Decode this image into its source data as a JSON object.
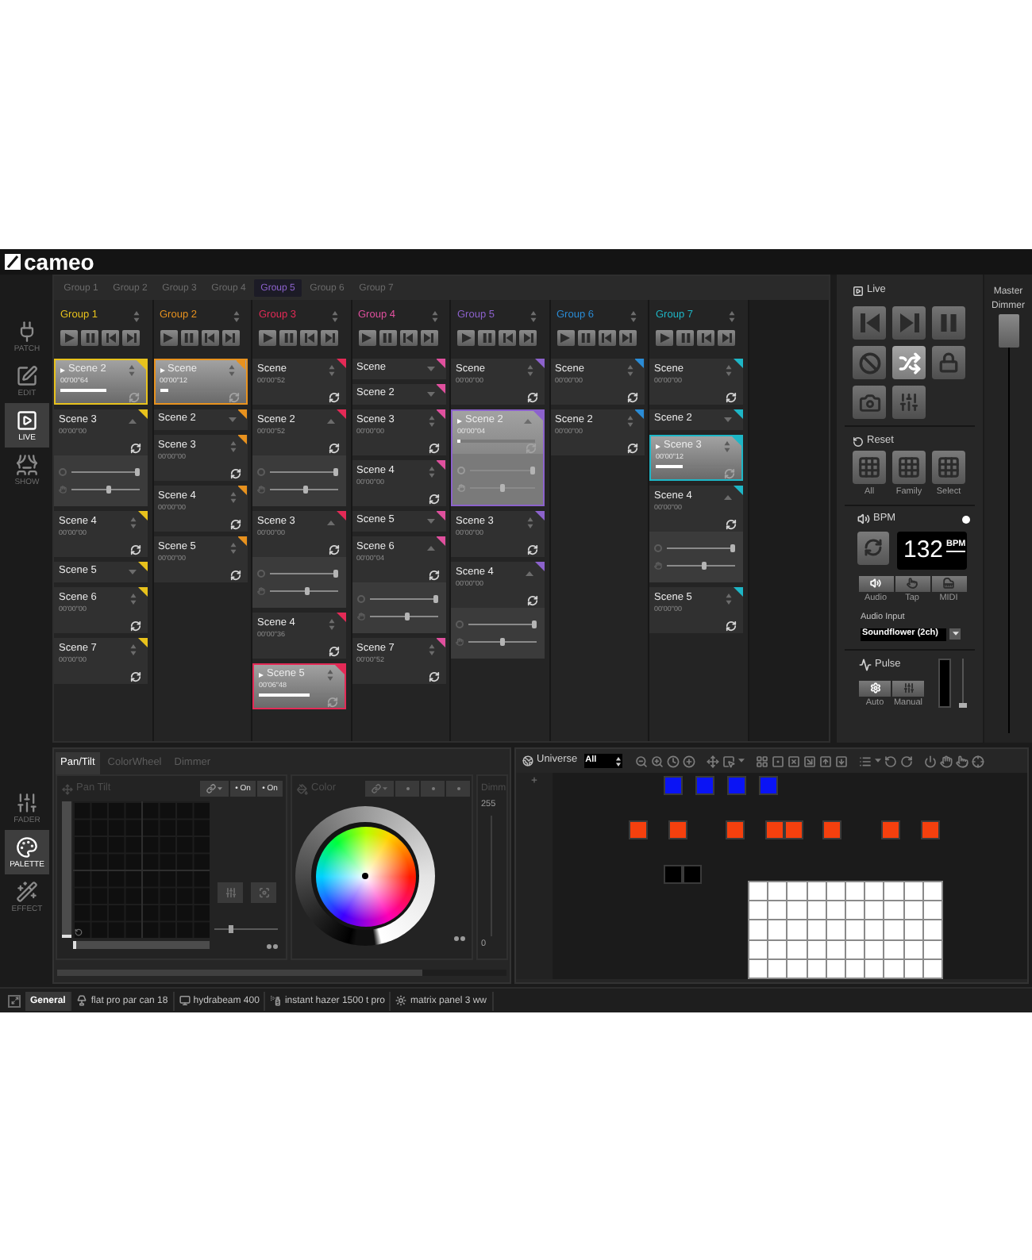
{
  "brand": "cameo",
  "side_nav": [
    {
      "label": "PATCH",
      "kind": "patch",
      "selected": false
    },
    {
      "label": "EDIT",
      "kind": "edit",
      "selected": false
    },
    {
      "label": "LIVE",
      "kind": "live",
      "selected": true
    },
    {
      "label": "SHOW",
      "kind": "show",
      "selected": false
    }
  ],
  "group_tabs": [
    {
      "label": "Group 1",
      "selected": false
    },
    {
      "label": "Group 2",
      "selected": false
    },
    {
      "label": "Group 3",
      "selected": false
    },
    {
      "label": "Group 4",
      "selected": false
    },
    {
      "label": "Group 5",
      "selected": true
    },
    {
      "label": "Group 6",
      "selected": false
    },
    {
      "label": "Group 7",
      "selected": false
    }
  ],
  "groups": [
    {
      "name": "Group 1",
      "color": "#e8c21c",
      "scenes": [
        {
          "name": "Scene 2",
          "time": "00'00\"64",
          "kind": "card",
          "playing": true,
          "level": 0.6
        },
        {
          "name": "Scene 3",
          "time": "00'00\"00",
          "kind": "expanded",
          "playing": false,
          "sliders": [
            {
              "level": 1
            },
            {
              "level": 0.55
            }
          ]
        },
        {
          "name": "Scene 4",
          "time": "00'00\"00",
          "kind": "card",
          "playing": false
        },
        {
          "name": "Scene 5",
          "kind": "collapsed",
          "playing": false
        },
        {
          "name": "Scene 6",
          "time": "00'00\"00",
          "kind": "card",
          "playing": false
        },
        {
          "name": "Scene 7",
          "time": "00'00\"00",
          "kind": "card",
          "playing": false
        }
      ]
    },
    {
      "name": "Group 2",
      "color": "#e8921e",
      "scenes": [
        {
          "name": "Scene",
          "time": "00'00\"12",
          "kind": "card",
          "playing": true,
          "level": 0.12
        },
        {
          "name": "Scene 2",
          "kind": "collapsed",
          "playing": false
        },
        {
          "name": "Scene 3",
          "time": "00'00\"00",
          "kind": "card",
          "playing": false
        },
        {
          "name": "Scene 4",
          "time": "00'00\"00",
          "kind": "card",
          "playing": false
        },
        {
          "name": "Scene 5",
          "time": "00'00\"00",
          "kind": "card",
          "playing": false
        }
      ]
    },
    {
      "name": "Group 3",
      "color": "#e42a56",
      "scenes": [
        {
          "name": "Scene",
          "time": "00'00\"52",
          "kind": "card",
          "playing": false
        },
        {
          "name": "Scene 2",
          "time": "00'00\"52",
          "kind": "expanded",
          "playing": false,
          "sliders": [
            {
              "level": 1
            },
            {
              "level": 0.52
            }
          ]
        },
        {
          "name": "Scene 3",
          "time": "00'00\"00",
          "kind": "expanded",
          "playing": false,
          "sliders": [
            {
              "level": 1
            },
            {
              "level": 0.55
            }
          ]
        },
        {
          "name": "Scene 4",
          "time": "00'00\"36",
          "kind": "card",
          "playing": false
        },
        {
          "name": "Scene 5",
          "time": "00'06\"48",
          "kind": "card",
          "playing": true,
          "level": 0.65
        }
      ]
    },
    {
      "name": "Group 4",
      "color": "#e0509e",
      "scenes": [
        {
          "name": "Scene",
          "kind": "collapsed",
          "playing": false
        },
        {
          "name": "Scene 2",
          "kind": "collapsed",
          "playing": false
        },
        {
          "name": "Scene 3",
          "time": "00'00\"00",
          "kind": "card",
          "playing": false
        },
        {
          "name": "Scene 4",
          "time": "00'00\"00",
          "kind": "card",
          "playing": false
        },
        {
          "name": "Scene 5",
          "kind": "collapsed",
          "playing": false
        },
        {
          "name": "Scene 6",
          "time": "00'00\"04",
          "kind": "expanded",
          "playing": false,
          "sliders": [
            {
              "level": 1
            },
            {
              "level": 0.55
            }
          ]
        },
        {
          "name": "Scene 7",
          "time": "00'00\"52",
          "kind": "card",
          "playing": false
        }
      ]
    },
    {
      "name": "Group 5",
      "color": "#8c62cc",
      "scenes": [
        {
          "name": "Scene",
          "time": "00'00\"00",
          "kind": "card",
          "playing": false
        },
        {
          "name": "Scene 2",
          "time": "00'00\"04",
          "kind": "expanded",
          "playing": true,
          "level": 0.04,
          "sliders": [
            {
              "level": 1
            },
            {
              "level": 0.5
            }
          ]
        },
        {
          "name": "Scene 3",
          "time": "00'00\"00",
          "kind": "card",
          "playing": false
        },
        {
          "name": "Scene 4",
          "time": "00'00\"00",
          "kind": "expanded",
          "playing": false,
          "sliders": [
            {
              "level": 1
            },
            {
              "level": 0.5
            }
          ]
        }
      ]
    },
    {
      "name": "Group 6",
      "color": "#2a8cd6",
      "scenes": [
        {
          "name": "Scene",
          "time": "00'00\"00",
          "kind": "card",
          "playing": false
        },
        {
          "name": "Scene 2",
          "time": "00'00\"00",
          "kind": "card",
          "playing": false
        }
      ]
    },
    {
      "name": "Group 7",
      "color": "#1eb6c6",
      "scenes": [
        {
          "name": "Scene",
          "time": "00'00\"00",
          "kind": "card",
          "playing": false
        },
        {
          "name": "Scene 2",
          "kind": "collapsed",
          "playing": false
        },
        {
          "name": "Scene 3",
          "time": "00'00\"12",
          "kind": "card",
          "playing": true,
          "level": 0.35
        },
        {
          "name": "Scene 4",
          "time": "00'00\"00",
          "kind": "expanded",
          "playing": false,
          "sliders": [
            {
              "level": 1
            },
            {
              "level": 0.55
            }
          ]
        },
        {
          "name": "Scene 5",
          "time": "00'00\"00",
          "kind": "card",
          "playing": false
        }
      ]
    }
  ],
  "live": {
    "title": "Live",
    "buttons": [
      {
        "kind": "previous",
        "on": false
      },
      {
        "kind": "next",
        "on": false
      },
      {
        "kind": "pause",
        "on": false
      },
      {
        "kind": "blackout",
        "on": false
      },
      {
        "kind": "shuffle",
        "on": true
      },
      {
        "kind": "lock",
        "on": false
      },
      {
        "kind": "snapshot",
        "on": false
      },
      {
        "kind": "mixer",
        "on": false
      }
    ]
  },
  "reset": {
    "title": "Reset",
    "buttons": [
      {
        "label": "All"
      },
      {
        "label": "Family"
      },
      {
        "label": "Select"
      }
    ]
  },
  "bpm": {
    "title": "BPM",
    "on": true,
    "value": "132",
    "unit": "BPM",
    "sources": [
      {
        "label": "Audio",
        "kind": "audio",
        "selected": true
      },
      {
        "label": "Tap",
        "kind": "tap",
        "selected": false
      },
      {
        "label": "MIDI",
        "kind": "midi",
        "selected": false
      }
    ],
    "audio_input": {
      "label": "Audio Input",
      "value": "Soundflower (2ch)"
    }
  },
  "pulse": {
    "title": "Pulse",
    "modes": [
      {
        "label": "Auto",
        "kind": "auto",
        "selected": true
      },
      {
        "label": "Manual",
        "kind": "manual",
        "selected": false
      }
    ],
    "slider": {
      "level": 0
    }
  },
  "master": {
    "label": "Master Dimmer",
    "level": 1
  },
  "tool_nav": [
    {
      "label": "FADER",
      "kind": "fader",
      "selected": false
    },
    {
      "label": "PALETTE",
      "kind": "palette",
      "selected": true
    },
    {
      "label": "EFFECT",
      "kind": "effect",
      "selected": false
    }
  ],
  "palette": {
    "tabs": [
      {
        "label": "Pan/Tilt",
        "selected": true
      },
      {
        "label": "ColorWheel",
        "selected": false
      },
      {
        "label": "Dimmer",
        "selected": false
      }
    ],
    "pan_tilt": {
      "title": "Pan Tilt",
      "toggles": [
        "• On",
        "• On"
      ],
      "tilt": {
        "level": 0
      },
      "pan": {
        "level": 0
      },
      "speed": {
        "level": 0.25
      }
    },
    "color": {
      "title": "Color"
    },
    "dimmer": {
      "title": "Dimm",
      "max": "255",
      "min": "0"
    }
  },
  "universe": {
    "title": "Universe",
    "filter": "All",
    "fixtures": [
      {
        "color": "#0a14f5"
      },
      {
        "color": "#0a14f5"
      },
      {
        "color": "#0a14f5"
      },
      {
        "color": "#0a14f5"
      },
      {
        "color": "#f5400e"
      },
      {
        "color": "#f5400e"
      },
      {
        "color": "#f5400e"
      },
      {
        "color": "#f5400e"
      },
      {
        "color": "#f5400e"
      },
      {
        "color": "#f5400e"
      },
      {
        "color": "#f5400e"
      },
      {
        "color": "#f5400e"
      },
      {
        "color": "#000000"
      },
      {
        "color": "#000000"
      }
    ],
    "matrix": {
      "color": "#ffffff"
    }
  },
  "status_bar": [
    {
      "label": "General",
      "kind": "general",
      "selected": true
    },
    {
      "label": "flat pro par can 18",
      "kind": "par_can",
      "selected": false
    },
    {
      "label": "hydrabeam 400",
      "kind": "moving_head",
      "selected": false
    },
    {
      "label": "instant hazer 1500 t pro",
      "kind": "hazer",
      "selected": false
    },
    {
      "label": "matrix panel 3 ww",
      "kind": "matrix",
      "selected": false
    }
  ]
}
